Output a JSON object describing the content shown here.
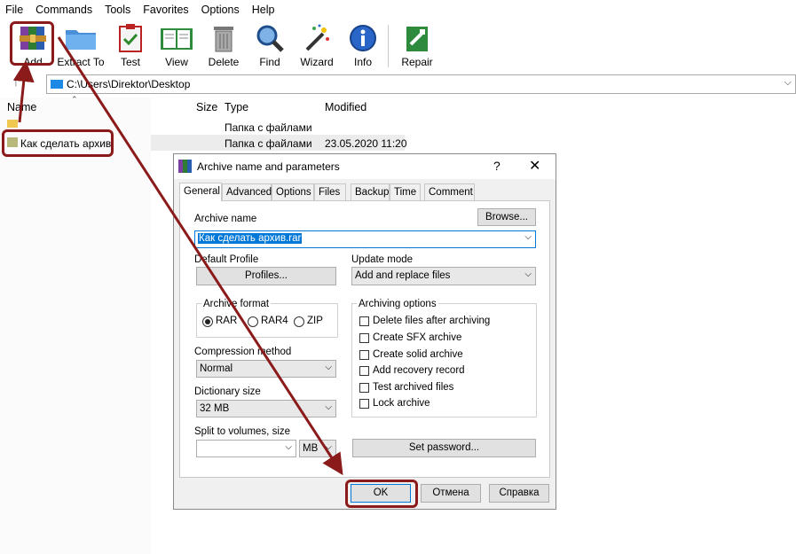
{
  "menu": [
    "File",
    "Commands",
    "Tools",
    "Favorites",
    "Options",
    "Help"
  ],
  "toolbar": {
    "add": "Add",
    "extract": "Extract To",
    "test": "Test",
    "view": "View",
    "delete": "Delete",
    "find": "Find",
    "wizard": "Wizard",
    "info": "Info",
    "repair": "Repair"
  },
  "path": "C:\\Users\\Direktor\\Desktop",
  "columns": {
    "name": "Name",
    "size": "Size",
    "type": "Type",
    "modified": "Modified"
  },
  "files": [
    {
      "name": "",
      "type": "Папка с файлами",
      "modified": ""
    },
    {
      "name": "Как сделать архив",
      "type": "Папка с файлами",
      "modified": "23.05.2020 11:20"
    }
  ],
  "dialog": {
    "title": "Archive name and parameters",
    "help_glyph": "?",
    "close_glyph": "✕",
    "tabs": [
      "General",
      "Advanced",
      "Options",
      "Files",
      "Backup",
      "Time",
      "Comment"
    ],
    "archive_name_label": "Archive name",
    "browse": "Browse...",
    "archive_name_value": "Как сделать архив.rar",
    "default_profile_label": "Default Profile",
    "profiles": "Profiles...",
    "update_mode_label": "Update mode",
    "update_mode_value": "Add and replace files",
    "archive_format_label": "Archive format",
    "formats": [
      "RAR",
      "RAR4",
      "ZIP"
    ],
    "archiving_options_label": "Archiving options",
    "options": [
      "Delete files after archiving",
      "Create SFX archive",
      "Create solid archive",
      "Add recovery record",
      "Test archived files",
      "Lock archive"
    ],
    "compression_label": "Compression method",
    "compression_value": "Normal",
    "dictionary_label": "Dictionary size",
    "dictionary_value": "32 MB",
    "split_label": "Split to volumes, size",
    "split_unit": "MB",
    "set_password": "Set password...",
    "ok": "OK",
    "cancel": "Отмена",
    "help": "Справка"
  },
  "colors": {
    "annotation": "#8b1a1a",
    "selection": "#0078d7"
  }
}
